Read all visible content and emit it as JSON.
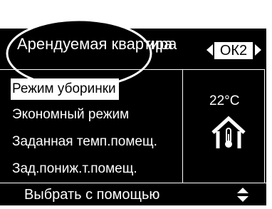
{
  "header": {
    "title": "Арендуемая квартира",
    "overlay_title": "Арендуемая квартира",
    "ok_label": "ОК2"
  },
  "menu": {
    "items": [
      {
        "label": "Режим уборинки",
        "selected": true
      },
      {
        "label": "Экономный режим",
        "selected": false
      },
      {
        "label": "Заданная темп.помещ.",
        "selected": false
      },
      {
        "label": "Зад.пониж.т.помещ.",
        "selected": false
      }
    ]
  },
  "status": {
    "temperature": "22°C",
    "icon": "house-thermometer-icon"
  },
  "footer": {
    "hint": "Выбрать с помощью",
    "icon": "up-down-arrows-icon"
  },
  "colors": {
    "background": "#000000",
    "foreground": "#ffffff"
  }
}
